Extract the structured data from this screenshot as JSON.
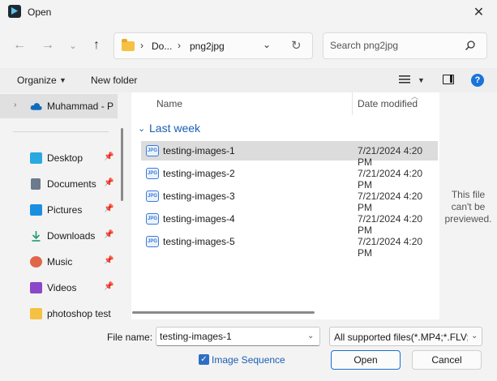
{
  "window": {
    "title": "Open"
  },
  "address": {
    "segments": [
      "Do...",
      "png2jpg"
    ]
  },
  "search": {
    "placeholder": "Search png2jpg"
  },
  "toolbar": {
    "organize_label": "Organize",
    "new_folder_label": "New folder"
  },
  "sidebar": {
    "items": [
      {
        "label": "Muhammad - P",
        "icon": "onedrive-cloud-icon",
        "color": "#0f6cbd"
      },
      {
        "label": "Desktop",
        "icon": "desktop-icon",
        "color": "#2aa8e0"
      },
      {
        "label": "Documents",
        "icon": "documents-icon",
        "color": "#6b7b8c"
      },
      {
        "label": "Pictures",
        "icon": "pictures-icon",
        "color": "#1a8fe0"
      },
      {
        "label": "Downloads",
        "icon": "downloads-icon",
        "color": "#1e9b6b"
      },
      {
        "label": "Music",
        "icon": "music-icon",
        "color": "#e0664a"
      },
      {
        "label": "Videos",
        "icon": "videos-icon",
        "color": "#8a48c8"
      },
      {
        "label": "photoshop test",
        "icon": "folder-icon",
        "color": "#f4c143"
      }
    ]
  },
  "filelist": {
    "columns": {
      "name": "Name",
      "date": "Date modified"
    },
    "group": "Last week",
    "rows": [
      {
        "name": "testing-images-1",
        "date": "7/21/2024 4:20 PM",
        "icon": "jpg-file-icon"
      },
      {
        "name": "testing-images-2",
        "date": "7/21/2024 4:20 PM",
        "icon": "jpg-file-icon"
      },
      {
        "name": "testing-images-3",
        "date": "7/21/2024 4:20 PM",
        "icon": "jpg-file-icon"
      },
      {
        "name": "testing-images-4",
        "date": "7/21/2024 4:20 PM",
        "icon": "jpg-file-icon"
      },
      {
        "name": "testing-images-5",
        "date": "7/21/2024 4:20 PM",
        "icon": "jpg-file-icon"
      }
    ],
    "file_icon_text": "JPG"
  },
  "preview": {
    "line1": "This file",
    "line2": "can't be",
    "line3": "previewed."
  },
  "bottom": {
    "filename_label": "File name:",
    "filename_value": "testing-images-1",
    "filetype_value": "All supported files(*.MP4;*.FLV;",
    "checkbox_label": "Image Sequence",
    "open_label": "Open",
    "cancel_label": "Cancel"
  },
  "colors": {
    "accent": "#1a6fd1",
    "selection": "#dcdcdc"
  }
}
